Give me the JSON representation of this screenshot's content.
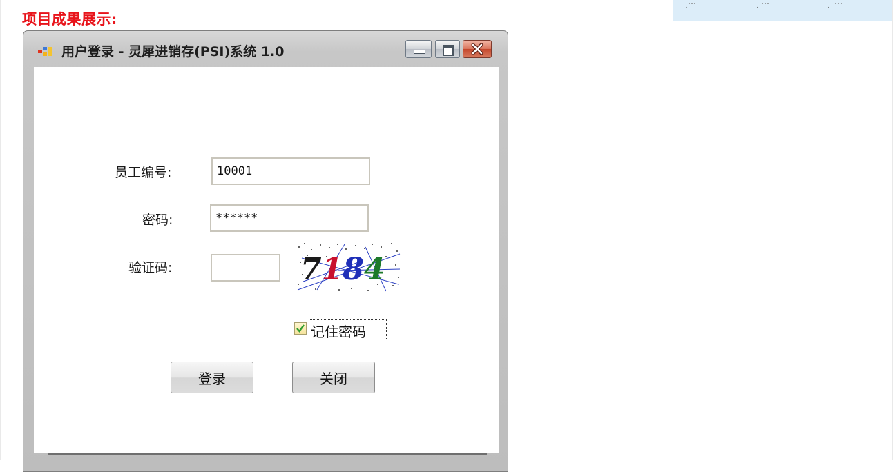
{
  "page": {
    "section_title": "项目成果展示:",
    "corner_links": [
      "…",
      "…",
      "…"
    ]
  },
  "window": {
    "title": "用户登录 - 灵犀进销存(PSI)系统 1.0",
    "title_buttons": {
      "minimize": "minimize-icon",
      "maximize": "maximize-icon",
      "close": "close-icon"
    }
  },
  "form": {
    "employee_id_label": "员工编号:",
    "employee_id_value": "10001",
    "password_label": "密码:",
    "password_value": "******",
    "captcha_label": "验证码:",
    "captcha_value": "",
    "captcha_text": "7184",
    "remember_label": "记住密码",
    "remember_checked": true,
    "login_button": "登录",
    "close_button": "关闭"
  },
  "colors": {
    "section_title": "#e8141b",
    "captcha_digits": [
      "#1a1a1a",
      "#c8102e",
      "#1f2fb8",
      "#1d7a2a"
    ]
  }
}
